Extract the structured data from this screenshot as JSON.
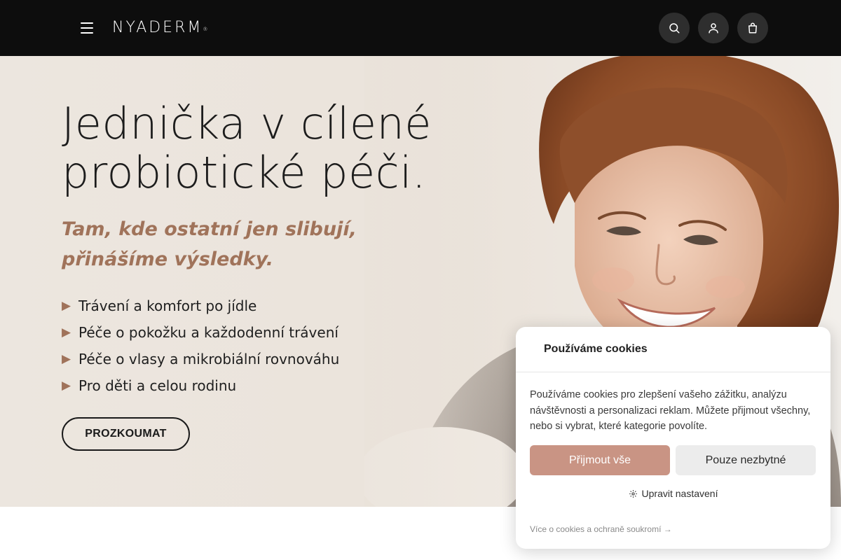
{
  "header": {
    "logo_text": "NYADERM",
    "logo_mark": "®",
    "icons": [
      "menu-icon",
      "search-icon",
      "user-icon",
      "bag-icon"
    ]
  },
  "hero": {
    "title_line1": "Jednička v cílené",
    "title_line2": "probiotické péči.",
    "subtitle_line1": "Tam, kde ostatní jen slibují,",
    "subtitle_line2": "přinášíme výsledky.",
    "bullet_symbol": "▶",
    "items": [
      {
        "label": "Trávení a komfort po jídle"
      },
      {
        "label": "Péče o pokožku a každodenní trávení"
      },
      {
        "label": "Péče o vlasy a mikrobiální rovnováhu"
      },
      {
        "label": "Pro děti a celou rodinu"
      }
    ],
    "cta_label": "PROZKOUMAT"
  },
  "cookie": {
    "icon": "",
    "title": "Používáme cookies",
    "text": "Používáme cookies pro zlepšení vašeho zážitku, analýzu návštěvnosti a personalizaci reklam. Můžete přijmout všechny, nebo si vybrat, které kategorie povolíte.",
    "accept_label": "Přijmout vše",
    "necessary_label": "Pouze nezbytné",
    "settings_label": "Upravit nastavení",
    "privacy_label": "Více o cookies a ochraně soukromí →"
  },
  "colors": {
    "header_bg": "#0d0d0d",
    "accent": "#a0735a",
    "accept_button": "#c99484",
    "secondary_button": "#ececec"
  }
}
